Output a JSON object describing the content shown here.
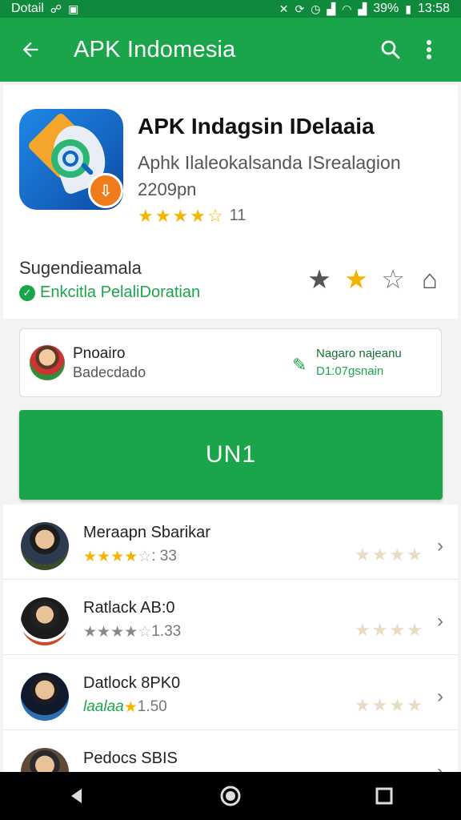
{
  "status_bar": {
    "left_text": "Dotail",
    "right_text": "39%",
    "time": "13:58"
  },
  "app_bar": {
    "title": "APK Indomesia"
  },
  "app": {
    "name": "APK Indagsin IDelaaia",
    "developer": "Aphk Ilaleokalsanda ISrealagion",
    "date": "2209pn",
    "rating_count": "11",
    "rating_stars": 4
  },
  "category": {
    "title": "Sugendieamala",
    "verified_label": "Enkcitla PelaliDoratian"
  },
  "rate_stars": [
    {
      "icon": "star-filled-dark-icon"
    },
    {
      "icon": "star-filled-gold-icon"
    },
    {
      "icon": "star-outline-icon"
    },
    {
      "icon": "house-outline-icon"
    }
  ],
  "author": {
    "name": "Pnoairo",
    "subtitle": "Badecdado",
    "edit_label": "Nagaro najeanu",
    "edit_sub": "D1:07gsnain"
  },
  "install_button": {
    "label": "UN1"
  },
  "reviews": [
    {
      "name": "Meraapn Sbarikar",
      "score": ": 33",
      "stars": 4,
      "avatar_color": "#3a4b2a"
    },
    {
      "name": "Ratlack AB:0",
      "score": "1.33",
      "stars": 4,
      "avatar_color": "#c8492b"
    },
    {
      "name": "Datlock 8PK0",
      "prefix": "laalaa",
      "score": "1.50",
      "stars": 1,
      "avatar_color": "#2a6fb0"
    },
    {
      "name": "Pedocs SBIS",
      "score": "",
      "stars": 0,
      "avatar_color": "#5d4a3a"
    }
  ],
  "colors": {
    "primary": "#1aa54a",
    "primary_dark": "#0f8a3c",
    "star": "#f5b400"
  }
}
